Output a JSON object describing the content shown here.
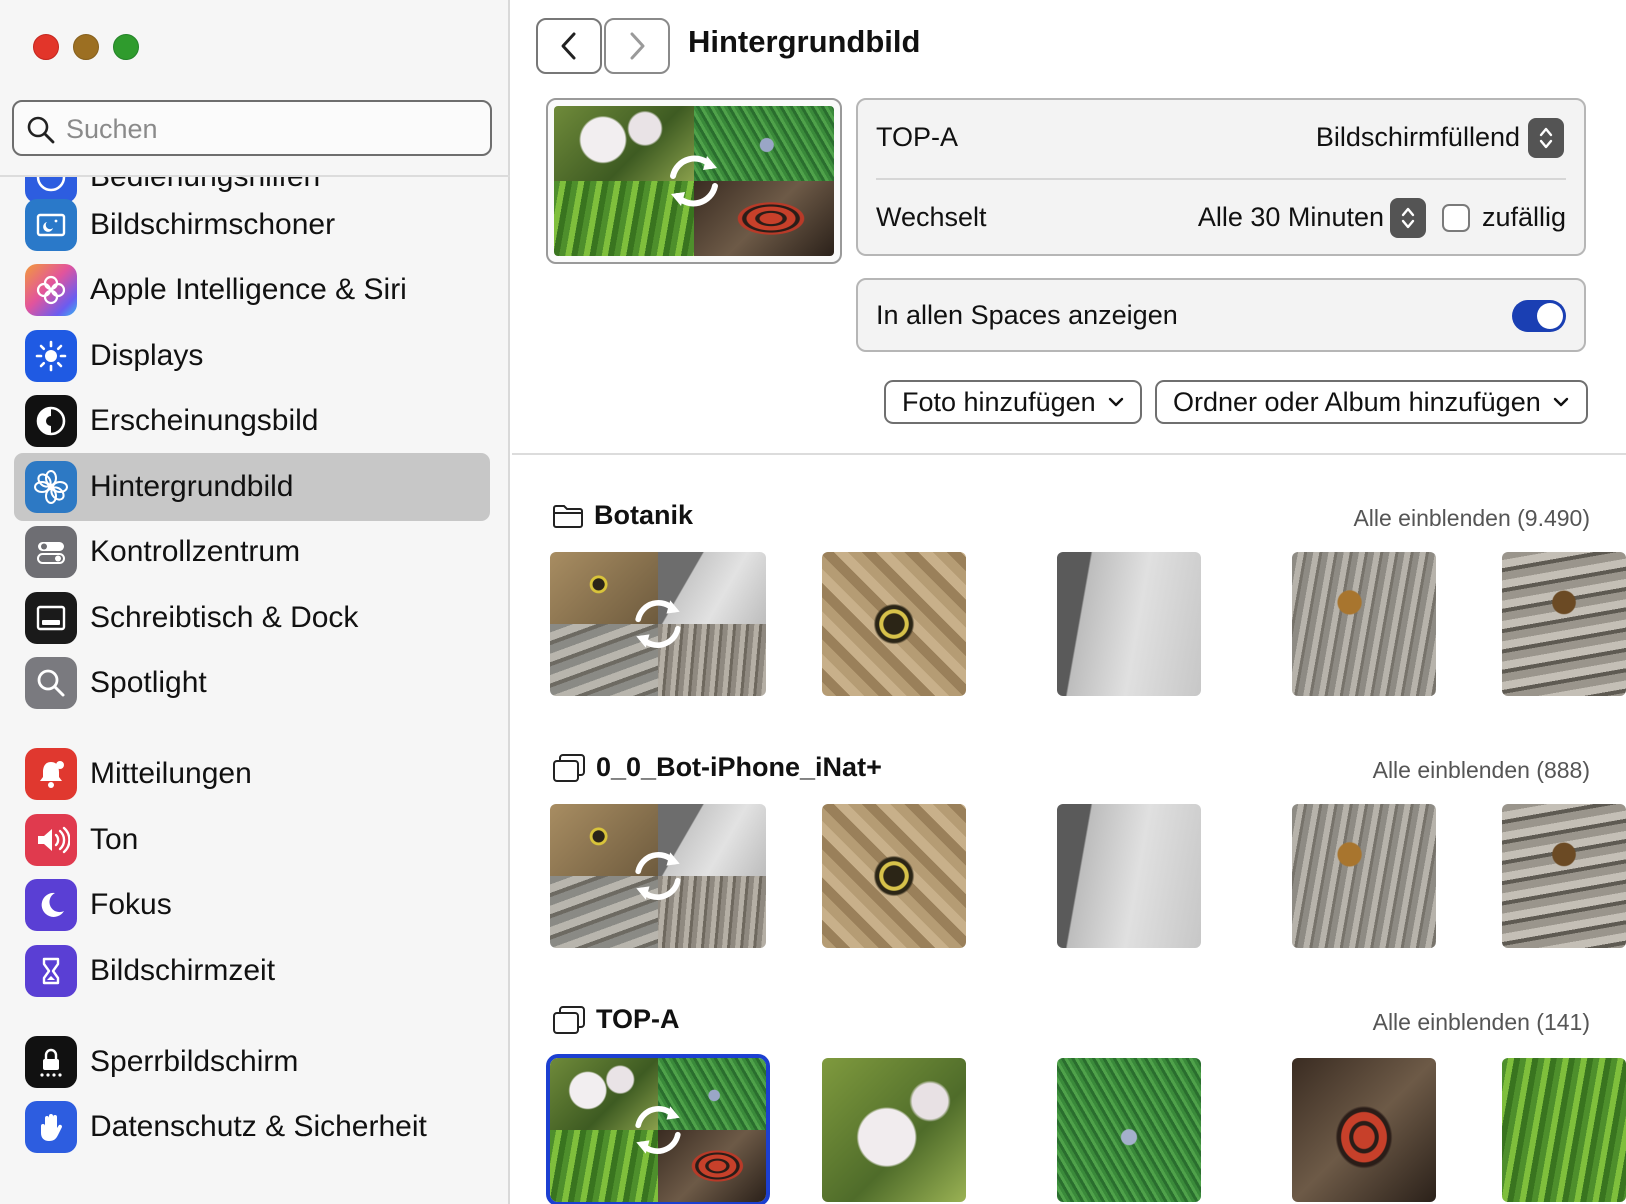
{
  "window": {
    "traffic_lights": {
      "close": "#e2352a",
      "minimize": "#9c6f22",
      "zoom": "#2f9b2d"
    }
  },
  "sidebar": {
    "search_placeholder": "Suchen",
    "partial_item_label": "Bedienungshilfen",
    "items": [
      {
        "label": "Bildschirmschoner",
        "icon": "screensaver-icon",
        "color": "#2a79c9"
      },
      {
        "label": "Apple Intelligence & Siri",
        "icon": "siri-icon",
        "color": "#d85aa6"
      },
      {
        "label": "Displays",
        "icon": "sun-icon",
        "color": "#1f5ae3"
      },
      {
        "label": "Erscheinungsbild",
        "icon": "appearance-icon",
        "color": "#111111"
      },
      {
        "label": "Hintergrundbild",
        "icon": "flower-icon",
        "color": "#2d79c4",
        "selected": true
      },
      {
        "label": "Kontrollzentrum",
        "icon": "switches-icon",
        "color": "#6e6e73"
      },
      {
        "label": "Schreibtisch & Dock",
        "icon": "dock-icon",
        "color": "#1a1a1a"
      },
      {
        "label": "Spotlight",
        "icon": "magnifier-icon",
        "color": "#7a7a7f"
      },
      {
        "label": "Mitteilungen",
        "icon": "bell-icon",
        "color": "#e0382f"
      },
      {
        "label": "Ton",
        "icon": "speaker-icon",
        "color": "#e03a4e"
      },
      {
        "label": "Fokus",
        "icon": "moon-icon",
        "color": "#5a3fd4"
      },
      {
        "label": "Bildschirmzeit",
        "icon": "hourglass-icon",
        "color": "#5a3fd4"
      },
      {
        "label": "Sperrbildschirm",
        "icon": "lock-icon",
        "color": "#111111"
      },
      {
        "label": "Datenschutz & Sicherheit",
        "icon": "hand-icon",
        "color": "#2d5de0"
      }
    ]
  },
  "header": {
    "title": "Hintergrundbild"
  },
  "wallpaper": {
    "name": "TOP-A",
    "fit": "Bildschirmfüllend",
    "change_label": "Wechselt",
    "change_interval": "Alle 30 Minuten",
    "random_label": "zufällig",
    "random_checked": false,
    "spaces_label": "In allen Spaces anzeigen",
    "spaces_enabled": true,
    "add_photo": "Foto hinzufügen",
    "add_folder": "Ordner oder Album hinzufügen"
  },
  "sections": [
    {
      "title": "Botanik",
      "link": "Alle einblenden (9.490)",
      "icon": "folder-icon"
    },
    {
      "title": "0_0_Bot-iPhone_iNat+",
      "link": "Alle einblenden (888)",
      "icon": "album-icon"
    },
    {
      "title": "TOP-A",
      "link": "Alle einblenden (141)",
      "icon": "album-icon"
    }
  ]
}
